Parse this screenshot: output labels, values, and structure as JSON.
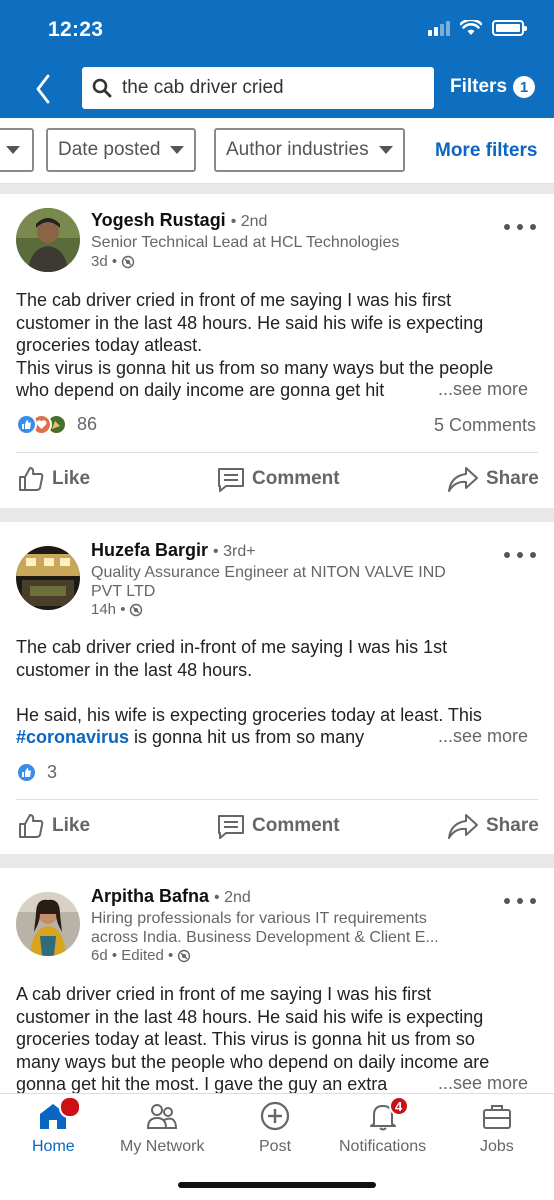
{
  "status": {
    "time": "12:23"
  },
  "search": {
    "query": "the cab driver cried"
  },
  "filters": {
    "label": "Filters",
    "count": "1"
  },
  "chips": [
    {
      "label": "Date posted"
    },
    {
      "label": "Author industries"
    }
  ],
  "more_filters": "More filters",
  "posts": [
    {
      "author": "Yogesh Rustagi",
      "degree": "• 2nd",
      "headline": [
        "Senior Technical Lead at HCL Technologies"
      ],
      "meta": "3d •",
      "text": [
        "The cab driver cried in front of me saying I was his first",
        "customer in the last 48 hours. He said his wife is expecting",
        "groceries today atleast.",
        "This virus is gonna hit us from so many ways but the people",
        "who depend on daily income are gonna get hit"
      ],
      "see_more": "...see more",
      "reaction_count": "86",
      "comments": "5 Comments"
    },
    {
      "author": "Huzefa Bargir",
      "degree": "• 3rd+",
      "headline": [
        "Quality Assurance Engineer at NITON VALVE IND",
        "PVT LTD"
      ],
      "meta": "14h •",
      "text": [
        "The cab driver cried in-front of me saying I was his 1st",
        "customer in the last 48 hours.",
        "",
        "He said, his wife is expecting groceries today at least. This"
      ],
      "hashtag": "#coronavirus",
      "text_last": " is gonna hit us from so many",
      "see_more": "...see more",
      "reaction_count": "3"
    },
    {
      "author": "Arpitha Bafna",
      "degree": "• 2nd",
      "headline": [
        "Hiring professionals for various IT requirements",
        "across India. Business Development & Client E..."
      ],
      "meta": "6d • Edited •",
      "text": [
        "A cab driver cried in front of me saying I was his first",
        "customer in the last 48 hours. He said his wife is expecting",
        "groceries today at least. This virus is gonna hit us from so",
        "many ways but the people who depend on daily income are",
        "gonna get hit the most. I gave the guy an extra"
      ],
      "see_more": "...see more"
    }
  ],
  "actions": {
    "like": "Like",
    "comment": "Comment",
    "share": "Share"
  },
  "nav": {
    "home": "Home",
    "network": "My Network",
    "post": "Post",
    "notifications": "Notifications",
    "notifications_badge": "4",
    "jobs": "Jobs"
  },
  "colors": {
    "brand": "#0e6ec0",
    "link": "#0a66c2",
    "badge": "#cc1016"
  }
}
